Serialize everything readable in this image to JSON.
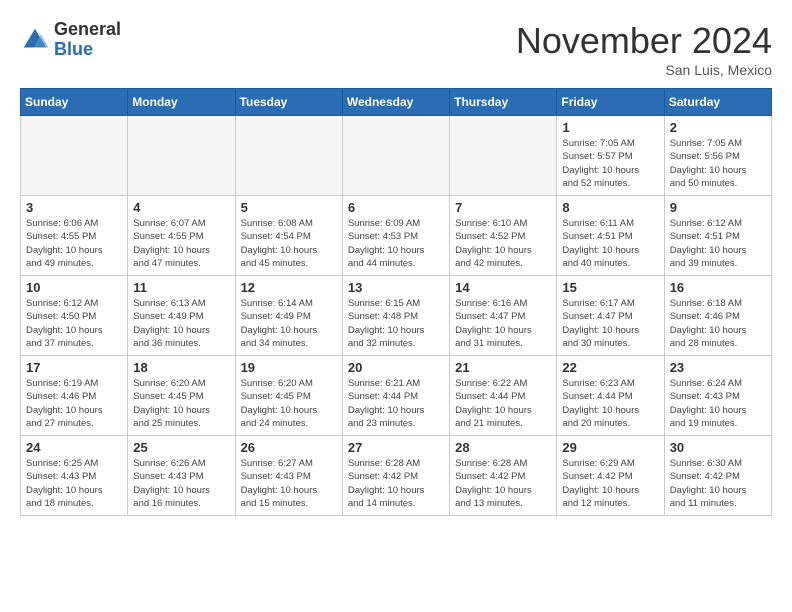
{
  "logo": {
    "general": "General",
    "blue": "Blue"
  },
  "title": "November 2024",
  "location": "San Luis, Mexico",
  "days_of_week": [
    "Sunday",
    "Monday",
    "Tuesday",
    "Wednesday",
    "Thursday",
    "Friday",
    "Saturday"
  ],
  "weeks": [
    [
      {
        "day": "",
        "info": "",
        "empty": true
      },
      {
        "day": "",
        "info": "",
        "empty": true
      },
      {
        "day": "",
        "info": "",
        "empty": true
      },
      {
        "day": "",
        "info": "",
        "empty": true
      },
      {
        "day": "",
        "info": "",
        "empty": true
      },
      {
        "day": "1",
        "info": "Sunrise: 7:05 AM\nSunset: 5:57 PM\nDaylight: 10 hours\nand 52 minutes."
      },
      {
        "day": "2",
        "info": "Sunrise: 7:05 AM\nSunset: 5:56 PM\nDaylight: 10 hours\nand 50 minutes."
      }
    ],
    [
      {
        "day": "3",
        "info": "Sunrise: 6:06 AM\nSunset: 4:55 PM\nDaylight: 10 hours\nand 49 minutes."
      },
      {
        "day": "4",
        "info": "Sunrise: 6:07 AM\nSunset: 4:55 PM\nDaylight: 10 hours\nand 47 minutes."
      },
      {
        "day": "5",
        "info": "Sunrise: 6:08 AM\nSunset: 4:54 PM\nDaylight: 10 hours\nand 45 minutes."
      },
      {
        "day": "6",
        "info": "Sunrise: 6:09 AM\nSunset: 4:53 PM\nDaylight: 10 hours\nand 44 minutes."
      },
      {
        "day": "7",
        "info": "Sunrise: 6:10 AM\nSunset: 4:52 PM\nDaylight: 10 hours\nand 42 minutes."
      },
      {
        "day": "8",
        "info": "Sunrise: 6:11 AM\nSunset: 4:51 PM\nDaylight: 10 hours\nand 40 minutes."
      },
      {
        "day": "9",
        "info": "Sunrise: 6:12 AM\nSunset: 4:51 PM\nDaylight: 10 hours\nand 39 minutes."
      }
    ],
    [
      {
        "day": "10",
        "info": "Sunrise: 6:12 AM\nSunset: 4:50 PM\nDaylight: 10 hours\nand 37 minutes."
      },
      {
        "day": "11",
        "info": "Sunrise: 6:13 AM\nSunset: 4:49 PM\nDaylight: 10 hours\nand 36 minutes."
      },
      {
        "day": "12",
        "info": "Sunrise: 6:14 AM\nSunset: 4:49 PM\nDaylight: 10 hours\nand 34 minutes."
      },
      {
        "day": "13",
        "info": "Sunrise: 6:15 AM\nSunset: 4:48 PM\nDaylight: 10 hours\nand 32 minutes."
      },
      {
        "day": "14",
        "info": "Sunrise: 6:16 AM\nSunset: 4:47 PM\nDaylight: 10 hours\nand 31 minutes."
      },
      {
        "day": "15",
        "info": "Sunrise: 6:17 AM\nSunset: 4:47 PM\nDaylight: 10 hours\nand 30 minutes."
      },
      {
        "day": "16",
        "info": "Sunrise: 6:18 AM\nSunset: 4:46 PM\nDaylight: 10 hours\nand 28 minutes."
      }
    ],
    [
      {
        "day": "17",
        "info": "Sunrise: 6:19 AM\nSunset: 4:46 PM\nDaylight: 10 hours\nand 27 minutes."
      },
      {
        "day": "18",
        "info": "Sunrise: 6:20 AM\nSunset: 4:45 PM\nDaylight: 10 hours\nand 25 minutes."
      },
      {
        "day": "19",
        "info": "Sunrise: 6:20 AM\nSunset: 4:45 PM\nDaylight: 10 hours\nand 24 minutes."
      },
      {
        "day": "20",
        "info": "Sunrise: 6:21 AM\nSunset: 4:44 PM\nDaylight: 10 hours\nand 23 minutes."
      },
      {
        "day": "21",
        "info": "Sunrise: 6:22 AM\nSunset: 4:44 PM\nDaylight: 10 hours\nand 21 minutes."
      },
      {
        "day": "22",
        "info": "Sunrise: 6:23 AM\nSunset: 4:44 PM\nDaylight: 10 hours\nand 20 minutes."
      },
      {
        "day": "23",
        "info": "Sunrise: 6:24 AM\nSunset: 4:43 PM\nDaylight: 10 hours\nand 19 minutes."
      }
    ],
    [
      {
        "day": "24",
        "info": "Sunrise: 6:25 AM\nSunset: 4:43 PM\nDaylight: 10 hours\nand 18 minutes."
      },
      {
        "day": "25",
        "info": "Sunrise: 6:26 AM\nSunset: 4:43 PM\nDaylight: 10 hours\nand 16 minutes."
      },
      {
        "day": "26",
        "info": "Sunrise: 6:27 AM\nSunset: 4:43 PM\nDaylight: 10 hours\nand 15 minutes."
      },
      {
        "day": "27",
        "info": "Sunrise: 6:28 AM\nSunset: 4:42 PM\nDaylight: 10 hours\nand 14 minutes."
      },
      {
        "day": "28",
        "info": "Sunrise: 6:28 AM\nSunset: 4:42 PM\nDaylight: 10 hours\nand 13 minutes."
      },
      {
        "day": "29",
        "info": "Sunrise: 6:29 AM\nSunset: 4:42 PM\nDaylight: 10 hours\nand 12 minutes."
      },
      {
        "day": "30",
        "info": "Sunrise: 6:30 AM\nSunset: 4:42 PM\nDaylight: 10 hours\nand 11 minutes."
      }
    ]
  ]
}
